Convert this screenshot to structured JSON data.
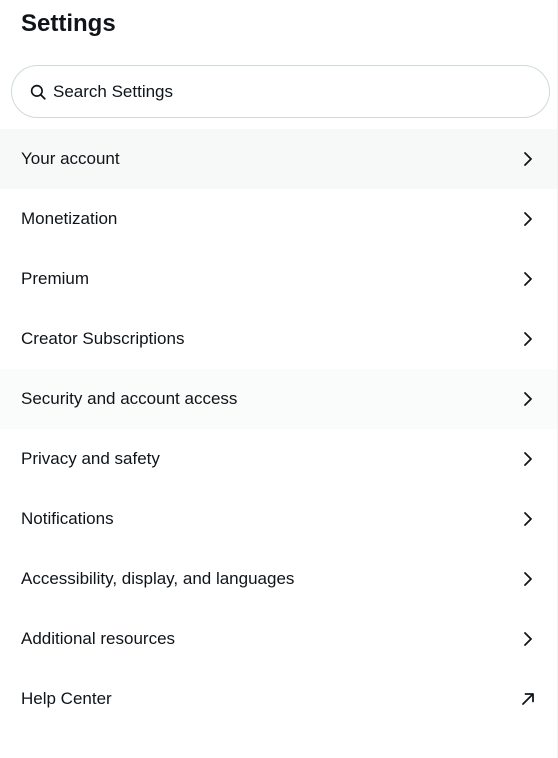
{
  "header": {
    "title": "Settings"
  },
  "search": {
    "placeholder": "Search Settings"
  },
  "menu": {
    "items": [
      {
        "label": "Your account",
        "icon": "chevron-right-icon"
      },
      {
        "label": "Monetization",
        "icon": "chevron-right-icon"
      },
      {
        "label": "Premium",
        "icon": "chevron-right-icon"
      },
      {
        "label": "Creator Subscriptions",
        "icon": "chevron-right-icon"
      },
      {
        "label": "Security and account access",
        "icon": "chevron-right-icon"
      },
      {
        "label": "Privacy and safety",
        "icon": "chevron-right-icon"
      },
      {
        "label": "Notifications",
        "icon": "chevron-right-icon"
      },
      {
        "label": "Accessibility, display, and languages",
        "icon": "chevron-right-icon"
      },
      {
        "label": "Additional resources",
        "icon": "chevron-right-icon"
      },
      {
        "label": "Help Center",
        "icon": "external-link-arrow-icon"
      }
    ]
  },
  "colors": {
    "text": "#0f1419",
    "active_row_bg": "#f7f9f9",
    "hover_row_bg": "#fafbfb",
    "search_border": "#cfd9de",
    "divider": "#eff3f4"
  }
}
